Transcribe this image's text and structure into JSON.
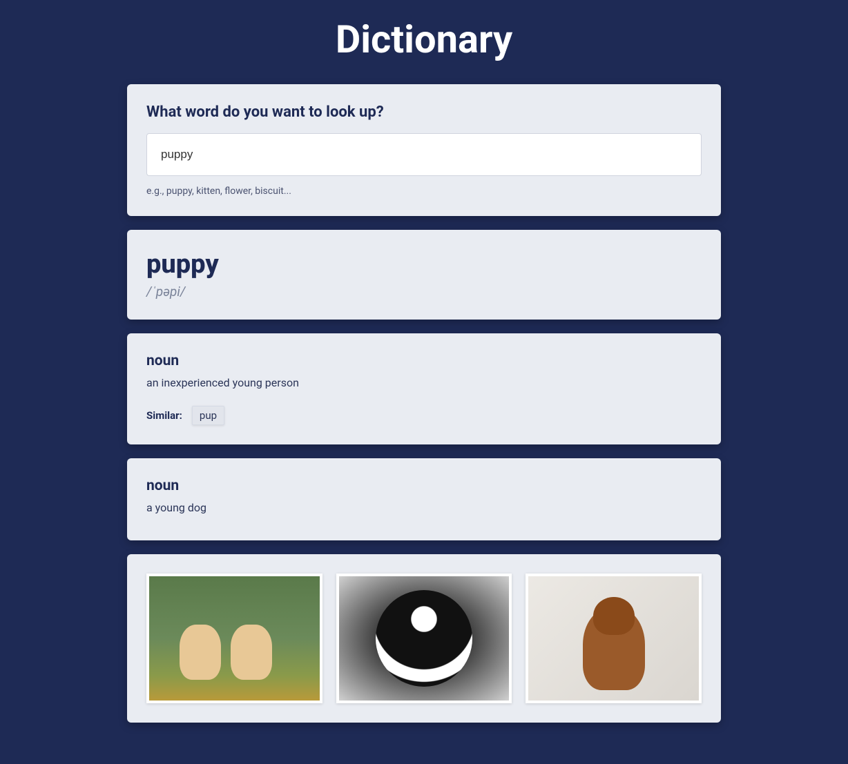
{
  "header": {
    "title": "Dictionary"
  },
  "search": {
    "label": "What word do you want to look up?",
    "value": "puppy",
    "hint": "e.g., puppy, kitten, flower, biscuit..."
  },
  "result": {
    "word": "puppy",
    "phonetic": "/ˈpəpi/"
  },
  "meanings": [
    {
      "partOfSpeech": "noun",
      "definition": "an inexperienced young person",
      "similarLabel": "Similar:",
      "similar": [
        "pup"
      ]
    },
    {
      "partOfSpeech": "noun",
      "definition": "a young dog"
    }
  ],
  "images": [
    {
      "alt": "two golden retriever puppies on grass"
    },
    {
      "alt": "black and white fluffy puppy face"
    },
    {
      "alt": "brown puppy sitting on light floor"
    }
  ]
}
